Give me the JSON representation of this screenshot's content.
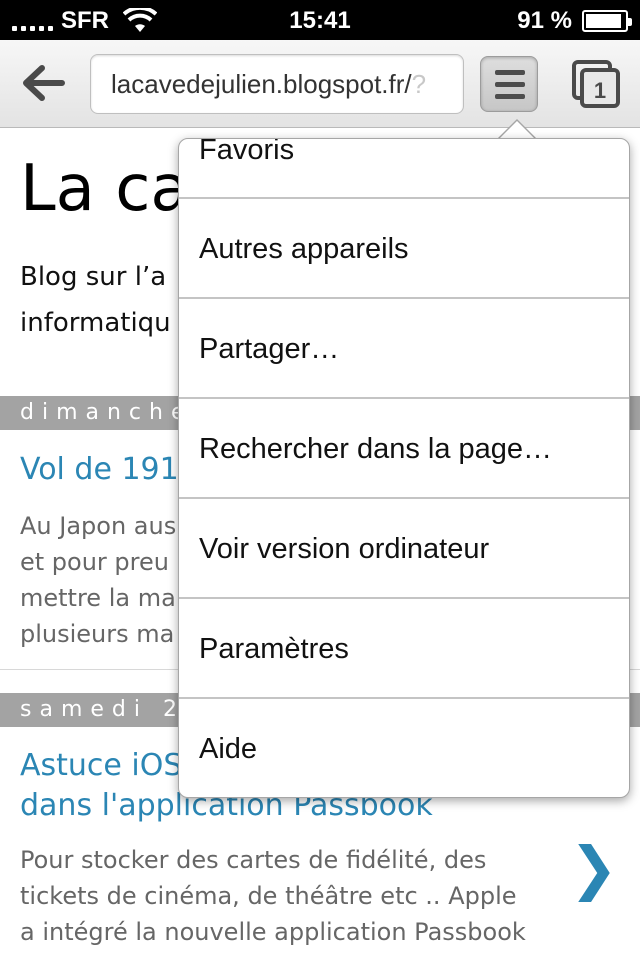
{
  "status_bar": {
    "carrier": "SFR",
    "time": "15:41",
    "battery_percent_label": "91 %",
    "battery_level": 0.91
  },
  "toolbar": {
    "url_visible": "lacavedejulien.blogspot.fr/",
    "url_faded": "?",
    "back_icon": "back-arrow-icon",
    "menu_icon": "hamburger-menu-icon",
    "tab_count": "1"
  },
  "page": {
    "blog_title_visible": "La ca",
    "blog_description_line1": "Blog sur l’a",
    "blog_description_line2": "informatiqu",
    "posts": [
      {
        "date_label": "dimanche",
        "title": "Vol de 191",
        "excerpt_lines": [
          "Au Japon aus",
          "et pour preu",
          "mettre la ma",
          "plusieurs ma"
        ]
      },
      {
        "date_label": "samedi 2",
        "title_line1": "Astuce iOS",
        "title_line2": "dans l'application Passbook",
        "excerpt_lines": [
          "Pour stocker des cartes de fidélité, des",
          "tickets de cinéma, de théâtre etc .. Apple",
          "a intégré la nouvelle application Passbook"
        ],
        "chevron": "❯"
      }
    ]
  },
  "menu": {
    "items": [
      {
        "label": "Favoris"
      },
      {
        "label": "Autres appareils"
      },
      {
        "label": "Partager…"
      },
      {
        "label": "Rechercher dans la page…"
      },
      {
        "label": "Voir version ordinateur"
      },
      {
        "label": "Paramètres"
      },
      {
        "label": "Aide"
      }
    ]
  },
  "colors": {
    "link_blue": "#2b86b4",
    "date_band_gray": "#a3a3a3"
  }
}
